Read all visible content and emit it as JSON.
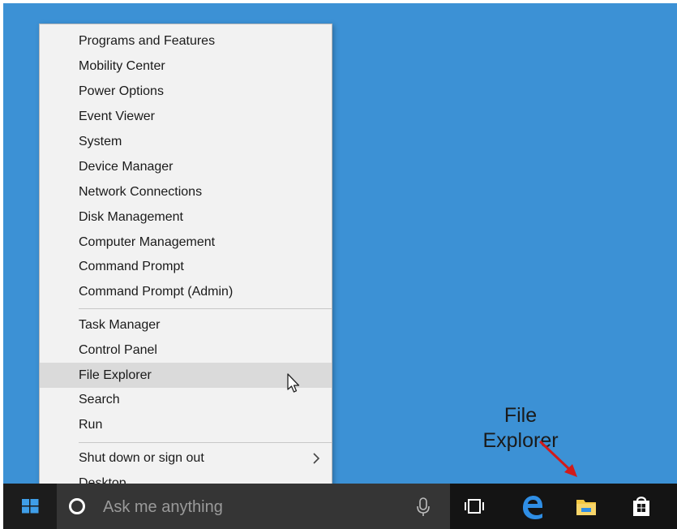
{
  "context_menu": {
    "group1": [
      "Programs and Features",
      "Mobility Center",
      "Power Options",
      "Event Viewer",
      "System",
      "Device Manager",
      "Network Connections",
      "Disk Management",
      "Computer Management",
      "Command Prompt",
      "Command Prompt (Admin)"
    ],
    "group2": [
      "Task Manager",
      "Control Panel",
      "File Explorer",
      "Search",
      "Run"
    ],
    "group3": [
      "Shut down or sign out",
      "Desktop"
    ],
    "highlighted_item": "File Explorer",
    "submenu_arrow": "›"
  },
  "taskbar": {
    "search_placeholder": "Ask me anything",
    "icons": [
      "windows-start-icon",
      "cortana-icon",
      "microphone-icon",
      "task-view-icon",
      "edge-icon",
      "file-explorer-icon",
      "store-icon"
    ]
  },
  "annotation": {
    "line1": "File",
    "line2": "Explorer",
    "arrow_color": "#d11b1b"
  },
  "colors": {
    "desktop": "#3c91d5",
    "taskbar": "#141414",
    "menu_bg": "#f2f2f2",
    "highlight": "#dadada",
    "start_blue": "#3f9ee8"
  }
}
